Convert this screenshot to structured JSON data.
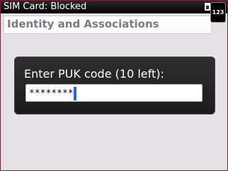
{
  "status_bar": {
    "title": "SIM Card: Blocked",
    "input_mode": "123"
  },
  "header": {
    "title": "Identity and Associations"
  },
  "dialog": {
    "label": "Enter PUK code (10 left):",
    "value": "********"
  },
  "colors": {
    "accent": "#1e6bd6",
    "dialog_bg": "#222222",
    "page_bg": "#e6e1e6"
  }
}
